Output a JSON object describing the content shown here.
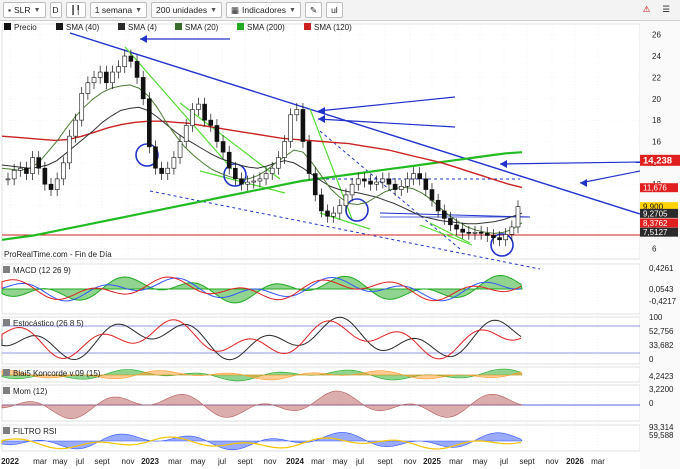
{
  "toolbar": {
    "symbol": "SLR",
    "period": "1 semana",
    "units": "200 unidades",
    "indicators": "Indicadores",
    "box_d": "D",
    "box_ul": "ul"
  },
  "legend": [
    {
      "label": "Precio",
      "color": "#111111"
    },
    {
      "label": "SMA (40)",
      "color": "#1a1a1a"
    },
    {
      "label": "SMA (4)",
      "color": "#2a2a2a"
    },
    {
      "label": "SMA (20)",
      "color": "#3a6b2a"
    },
    {
      "label": "SMA (200)",
      "color": "#22aa22"
    },
    {
      "label": "SMA (120)",
      "color": "#cc2222"
    }
  ],
  "source": "ProRealTime.com - Fin de Día",
  "price_axis": {
    "ticks": [
      "26",
      "24",
      "22",
      "20",
      "18",
      "16",
      "14",
      "12",
      "10",
      "8",
      "6"
    ],
    "tags": [
      {
        "text": "14,238",
        "value": 14.238,
        "color": "#e02020",
        "big": true
      },
      {
        "text": "11,676",
        "value": 11.676,
        "color": "#e02020"
      },
      {
        "text": "9,900",
        "value": 9.9,
        "color": "#ffd200",
        "dark": true
      },
      {
        "text": "9,2705",
        "value": 9.2705,
        "color": "#2a2a2a"
      },
      {
        "text": "8,3762",
        "value": 8.3762,
        "color": "#e02020"
      },
      {
        "text": "7,5127",
        "value": 7.5127,
        "color": "#2a2a2a"
      }
    ]
  },
  "x_axis": [
    "2022",
    "mar",
    "may",
    "jul",
    "sept",
    "nov",
    "2023",
    "mar",
    "may",
    "jul",
    "sept",
    "nov",
    "2024",
    "mar",
    "may",
    "jul",
    "sept",
    "nov",
    "2025",
    "mar",
    "may",
    "jul",
    "sept",
    "nov",
    "2026",
    "mar"
  ],
  "panels": {
    "macd": {
      "label": "MACD (12 26 9)",
      "ticks": [
        "0,4261",
        "0,0543",
        "-0,4217"
      ],
      "colors": [
        "#22aa22",
        "#3355ff",
        "#e02020"
      ]
    },
    "stoch": {
      "label": "Estocástico (26 8 5)",
      "ticks": [
        "100",
        "52,756",
        "33,682",
        "0"
      ],
      "colors": [
        "#2a2a2a",
        "#22aa22",
        "#e02020"
      ]
    },
    "blai": {
      "label": "Blai5 Koncorde v.09 (15)",
      "ticks": [
        "4,2423"
      ],
      "colors": [
        "#22aa22"
      ]
    },
    "mom": {
      "label": "Mom (12)",
      "ticks": [
        "3,2200",
        "0"
      ],
      "colors": [
        "#2a2a2a",
        "#3355ff"
      ]
    },
    "rsi": {
      "label": "FILTRO RSI",
      "ticks": [
        "93,314",
        "59,588"
      ],
      "colors": [
        "#3355ff",
        "#f5c400"
      ]
    }
  },
  "chart_data": {
    "type": "line",
    "title": "SLR",
    "x_start": "2022-01",
    "y_range": [
      5,
      27
    ],
    "price": [
      12.5,
      13.3,
      13.5,
      13.0,
      14.5,
      13.5,
      12.0,
      11.5,
      12.5,
      14.0,
      16.5,
      18.0,
      20.5,
      21.5,
      22.0,
      22.5,
      21.5,
      22.5,
      23.0,
      24.0,
      23.5,
      22.0,
      20.0,
      15.5,
      13.5,
      13.0,
      13.5,
      14.5,
      16.0,
      17.5,
      19.0,
      19.5,
      18.0,
      17.5,
      16.0,
      15.0,
      13.5,
      12.5,
      12.0,
      12.2,
      12.3,
      12.5,
      13.0,
      13.5,
      14.5,
      16.0,
      18.5,
      19.0,
      16.0,
      13.0,
      11.0,
      9.5,
      9.0,
      9.3,
      10.0,
      11.0,
      12.0,
      12.5,
      12.3,
      12.0,
      12.2,
      12.5,
      12.0,
      11.5,
      11.8,
      12.5,
      13.0,
      12.5,
      11.5,
      10.5,
      9.5,
      8.8,
      8.2,
      7.8,
      7.5,
      7.4,
      7.5,
      7.4,
      7.2,
      7.0,
      6.8,
      7.3,
      8.0,
      9.9
    ],
    "sma40": [
      13.8,
      13.7,
      13.6,
      13.5,
      13.6,
      13.8,
      14.2,
      14.9,
      15.6,
      16.3,
      17.0,
      17.8,
      18.4,
      18.9,
      19.1,
      19.2,
      18.9,
      18.3,
      17.6,
      16.9,
      16.3,
      15.8,
      15.3,
      14.8,
      14.4,
      14.1,
      13.8,
      13.6,
      13.5,
      13.7,
      14.0,
      14.2,
      14.0,
      13.5,
      12.9,
      12.3,
      11.8,
      11.5,
      11.3,
      11.2,
      11.0,
      10.8,
      10.5,
      10.2,
      9.8,
      9.4,
      9.0,
      8.8,
      8.6,
      8.5,
      8.4,
      8.3,
      8.3,
      8.4,
      8.5,
      8.7,
      9.0,
      9.3
    ],
    "sma20": [
      13.5,
      13.4,
      13.3,
      13.5,
      14.0,
      15.0,
      16.0,
      17.2,
      18.3,
      19.2,
      20.0,
      20.6,
      21.0,
      21.2,
      21.3,
      21.0,
      20.3,
      19.2,
      17.8,
      16.6,
      15.5,
      14.7,
      14.0,
      13.4,
      13.0,
      12.7,
      12.5,
      12.5,
      12.8,
      13.3,
      14.0,
      14.6,
      15.2,
      15.0,
      14.0,
      12.8,
      11.6,
      10.8,
      10.2,
      10.1,
      10.3,
      10.8,
      11.3,
      11.6,
      11.7,
      11.6,
      11.2,
      10.6,
      9.8,
      9.1,
      8.5,
      8.0,
      7.7,
      7.5,
      7.4,
      7.5,
      7.8,
      8.4
    ],
    "sma200": [
      6.8,
      7.0,
      7.2,
      7.5,
      7.8,
      8.1,
      8.4,
      8.7,
      9.0,
      9.3,
      9.6,
      9.9,
      10.2,
      10.5,
      10.8,
      11.1,
      11.4,
      11.7,
      12.0,
      12.3,
      12.5,
      12.7,
      12.9,
      13.1,
      13.3,
      13.5,
      13.7,
      13.9,
      14.1,
      14.3,
      14.5,
      14.7,
      14.9,
      15.0
    ],
    "sma120": [
      16.5,
      16.4,
      16.3,
      16.2,
      16.1,
      16.2,
      16.5,
      16.9,
      17.3,
      17.6,
      17.8,
      17.9,
      17.9,
      17.8,
      17.7,
      17.5,
      17.3,
      17.1,
      16.9,
      16.7,
      16.5,
      16.3,
      16.2,
      16.1,
      16.0,
      15.9,
      15.8,
      15.6,
      15.4,
      15.2,
      14.9,
      14.6,
      14.3,
      14.0,
      13.6,
      13.2,
      12.8,
      12.4,
      12.0,
      11.7
    ]
  }
}
